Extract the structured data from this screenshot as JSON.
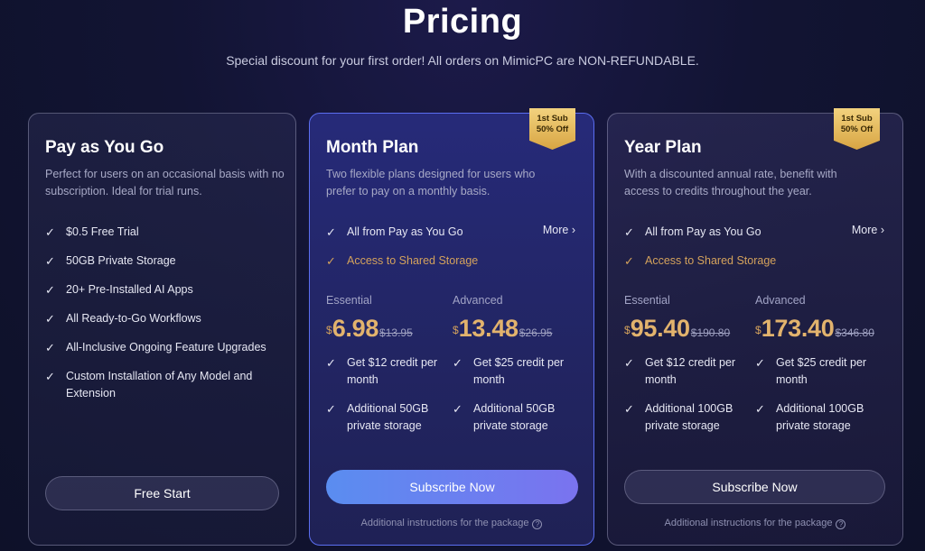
{
  "header": {
    "title": "Pricing",
    "subtitle": "Special discount for your first order! All orders on MimicPC are NON-REFUNDABLE."
  },
  "plans": [
    {
      "title": "Pay as You Go",
      "description": "Perfect for users on an occasional basis with no subscription. Ideal for trial runs.",
      "features": [
        "$0.5 Free Trial",
        "50GB Private Storage",
        "20+ Pre-Installed AI Apps",
        "All Ready-to-Go Workflows",
        "All-Inclusive Ongoing Feature Upgrades",
        "Custom Installation of Any Model and Extension"
      ],
      "button": "Free Start"
    },
    {
      "title": "Month Plan",
      "badge": {
        "line1": "1st Sub",
        "line2": "50% Off"
      },
      "description": "Two flexible plans designed for users who prefer to pay on a monthly basis.",
      "features": [
        "All from Pay as You Go",
        "Access to Shared Storage"
      ],
      "more": "More",
      "tiers": [
        {
          "label": "Essential",
          "currency": "$",
          "price": "6.98",
          "old_price": "$13.95",
          "features": [
            "Get $12 credit per month",
            "Additional 50GB private storage"
          ]
        },
        {
          "label": "Advanced",
          "currency": "$",
          "price": "13.48",
          "old_price": "$26.95",
          "features": [
            "Get $25 credit per month",
            "Additional 50GB private storage"
          ]
        }
      ],
      "button": "Subscribe Now",
      "note": "Additional instructions for the package"
    },
    {
      "title": "Year Plan",
      "badge": {
        "line1": "1st Sub",
        "line2": "50% Off"
      },
      "description": "With a discounted annual rate, benefit with access to credits throughout the year.",
      "features": [
        "All from Pay as You Go",
        "Access to Shared Storage"
      ],
      "more": "More",
      "tiers": [
        {
          "label": "Essential",
          "currency": "$",
          "price": "95.40",
          "old_price": "$190.80",
          "features": [
            "Get $12 credit per month",
            "Additional 100GB private storage"
          ]
        },
        {
          "label": "Advanced",
          "currency": "$",
          "price": "173.40",
          "old_price": "$346.80",
          "features": [
            "Get $25 credit per month",
            "Additional 100GB private storage"
          ]
        }
      ],
      "button": "Subscribe Now",
      "note": "Additional instructions for the package"
    }
  ],
  "colors": {
    "accent_gold": "#e2b36d",
    "primary_button_start": "#5a8df0",
    "primary_button_end": "#7a73ef",
    "highlight_border": "#5b6ef0"
  },
  "icons": {
    "check": "check-icon",
    "chevron": "chevron-right-icon",
    "help": "help-circle-icon"
  }
}
